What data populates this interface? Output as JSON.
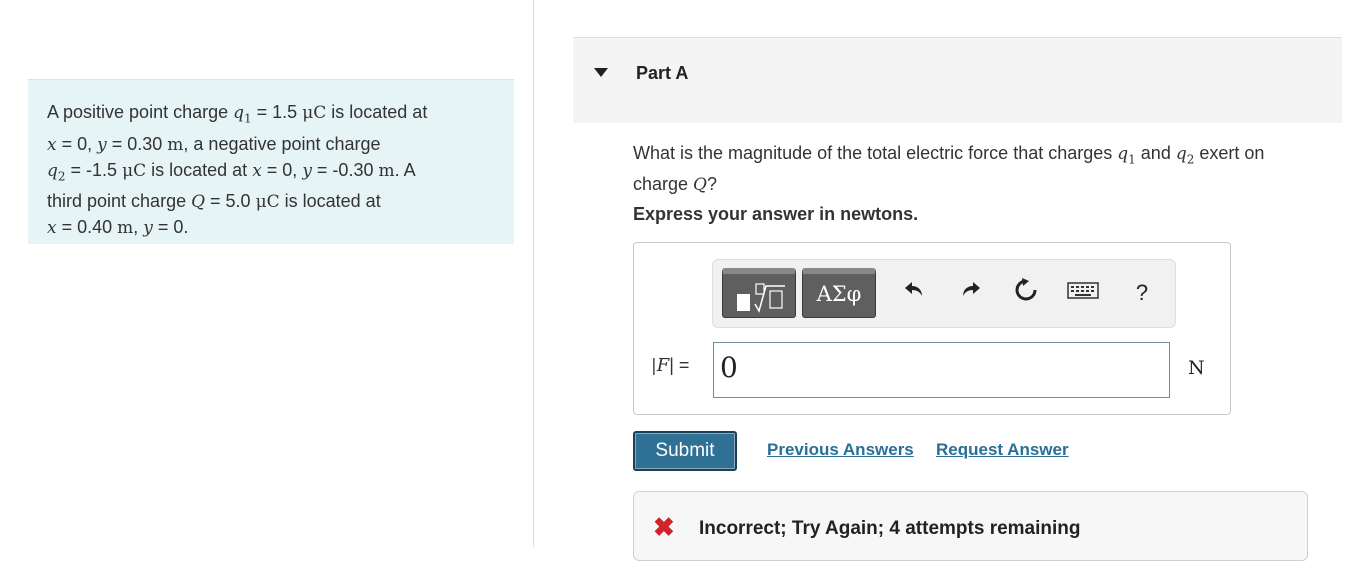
{
  "problem": {
    "s1": "A positive point charge ",
    "q1_sym": "q",
    "q1_sub": "1",
    "s2": " = 1.5 ",
    "unit_uC": "μC",
    "s3": " is located at",
    "x_sym": "x",
    "s4": " = 0, ",
    "y_sym": "y",
    "s5": " = 0.30 ",
    "unit_m": "m",
    "s6": ", a negative point charge",
    "q2_sym": "q",
    "q2_sub": "2",
    "s7": " = -1.5 ",
    "s8": " is located at ",
    "s9": " = 0, ",
    "s10": " = -0.30 ",
    "s11": ". A",
    "s12": "third point charge ",
    "Q_sym": "Q",
    "s13": " = 5.0 ",
    "s14": " is located at",
    "s15": " = 0.40 ",
    "s16": ", ",
    "s17": " = 0."
  },
  "part": {
    "title": "Part A"
  },
  "question": {
    "t1": "What is the magnitude of the total electric force that charges ",
    "t2": " and ",
    "t3": " exert on",
    "t4": "charge ",
    "t5": "?"
  },
  "instruction": "Express your answer in newtons.",
  "toolbar": {
    "templates_icon": "templates-icon",
    "symbols_label": "ΑΣφ",
    "undo_icon": "undo-icon",
    "redo_icon": "redo-icon",
    "reset_icon": "reset-icon",
    "keyboard_icon": "keyboard-icon",
    "help_label": "?"
  },
  "answer": {
    "lhs_bar": "|",
    "lhs_var": "F",
    "lhs_eq": "| =",
    "value": "0",
    "unit": "N"
  },
  "actions": {
    "submit": "Submit",
    "previous": "Previous Answers",
    "request": "Request Answer"
  },
  "feedback": {
    "icon": "x-icon",
    "text": "Incorrect; Try Again; 4 attempts remaining"
  },
  "colors": {
    "problem_bg": "#e7f4f6",
    "submit_bg": "#2f7195",
    "link": "#2a6f96",
    "error": "#d0232a"
  }
}
